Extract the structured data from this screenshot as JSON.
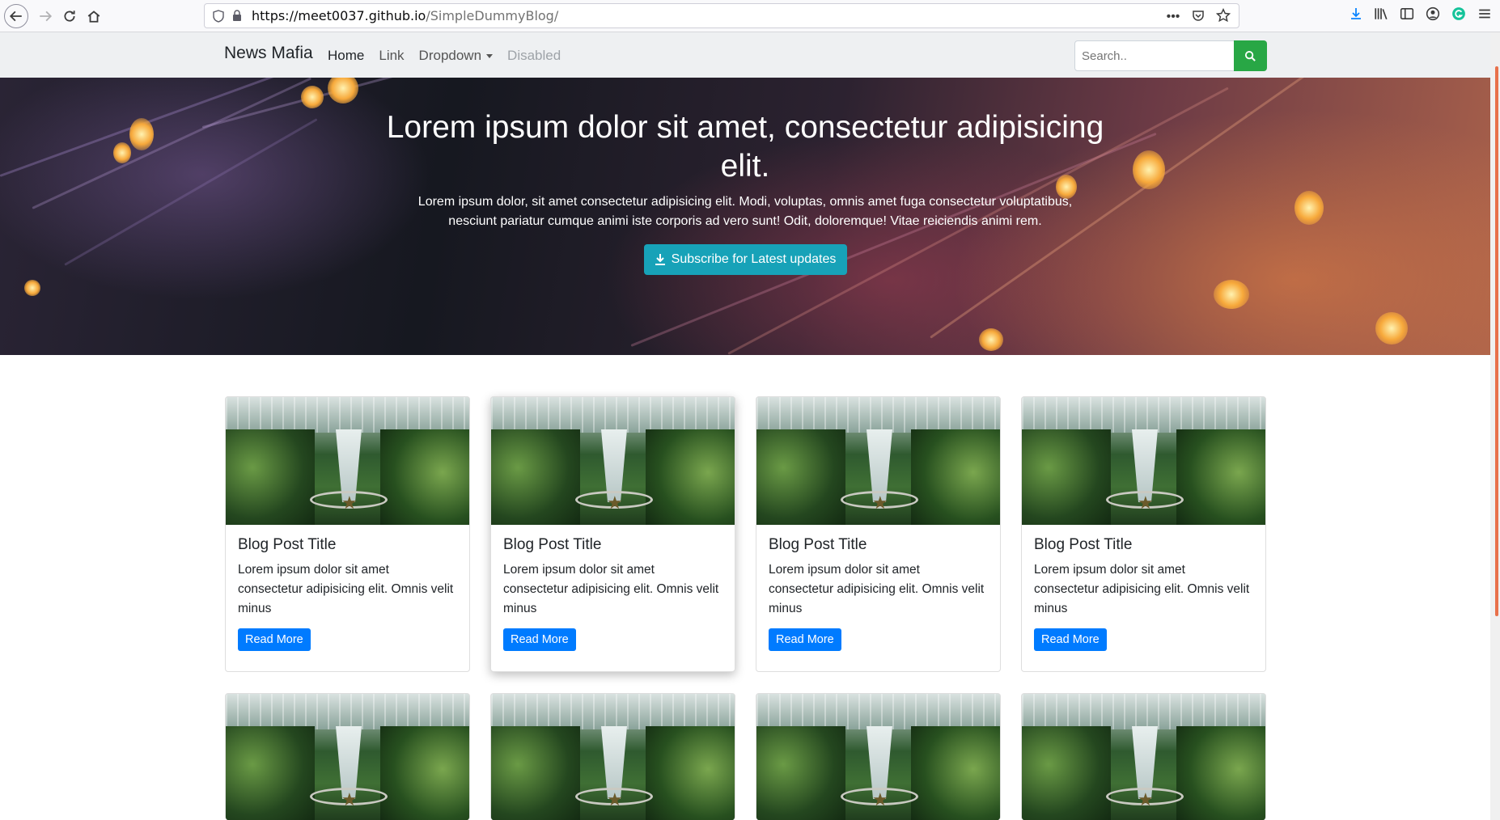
{
  "browser": {
    "url_host": "https://meet0037.github.io",
    "url_path": "/SimpleDummyBlog/"
  },
  "navbar": {
    "brand": "News Mafia",
    "links": [
      "Home",
      "Link",
      "Dropdown",
      "Disabled"
    ],
    "search_placeholder": "Search.."
  },
  "hero": {
    "title": "Lorem ipsum dolor sit amet, consectetur adipisicing elit.",
    "text": "Lorem ipsum dolor, sit amet consectetur adipisicing elit. Modi, voluptas, omnis amet fuga consectetur voluptatibus, nesciunt pariatur cumque animi iste corporis ad vero sunt! Odit, doloremque! Vitae reiciendis animi rem.",
    "button": "Subscribe for Latest updates"
  },
  "cards": [
    {
      "title": "Blog Post Title",
      "text": "Lorem ipsum dolor sit amet consectetur adipisicing elit. Omnis velit minus",
      "button": "Read More"
    },
    {
      "title": "Blog Post Title",
      "text": "Lorem ipsum dolor sit amet consectetur adipisicing elit. Omnis velit minus",
      "button": "Read More"
    },
    {
      "title": "Blog Post Title",
      "text": "Lorem ipsum dolor sit amet consectetur adipisicing elit. Omnis velit minus",
      "button": "Read More"
    },
    {
      "title": "Blog Post Title",
      "text": "Lorem ipsum dolor sit amet consectetur adipisicing elit. Omnis velit minus",
      "button": "Read More"
    }
  ],
  "colors": {
    "accent_green": "#28a745",
    "accent_teal": "#17a2b8",
    "accent_blue": "#007bff"
  }
}
